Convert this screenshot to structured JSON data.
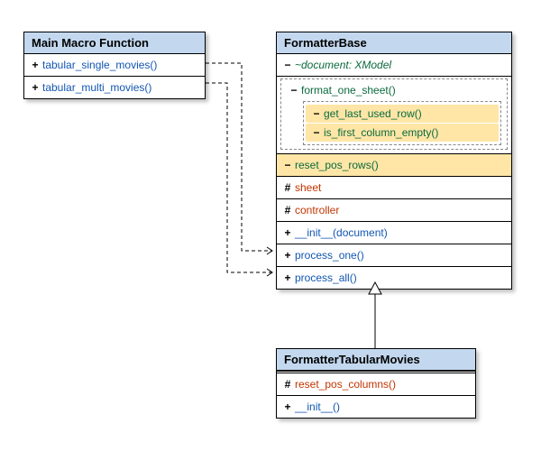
{
  "mainMacro": {
    "title": "Main Macro Function",
    "methods": [
      {
        "vis": "+",
        "name": "tabular_single_movies()"
      },
      {
        "vis": "+",
        "name": "tabular_multi_movies()"
      }
    ]
  },
  "formatterBase": {
    "title": "FormatterBase",
    "attr_document": {
      "vis": "−",
      "name": "~document: XModel"
    },
    "format_one_sheet": {
      "vis": "−",
      "name": "format_one_sheet()"
    },
    "nested": [
      {
        "vis": "−",
        "name": "get_last_used_row()"
      },
      {
        "vis": "−",
        "name": "is_first_column_empty()"
      }
    ],
    "reset_pos_rows": {
      "vis": "−",
      "name": "reset_pos_rows()"
    },
    "protected": [
      {
        "vis": "#",
        "name": "sheet"
      },
      {
        "vis": "#",
        "name": "controller"
      }
    ],
    "publics": [
      {
        "vis": "+",
        "name": "__init__(document)"
      },
      {
        "vis": "+",
        "name": "process_one()"
      },
      {
        "vis": "+",
        "name": "process_all()"
      }
    ]
  },
  "formatterTabularMovies": {
    "title": "FormatterTabularMovies",
    "reset_pos_columns": {
      "vis": "#",
      "name": "reset_pos_columns()"
    },
    "init": {
      "vis": "+",
      "name": "__init__()"
    }
  }
}
